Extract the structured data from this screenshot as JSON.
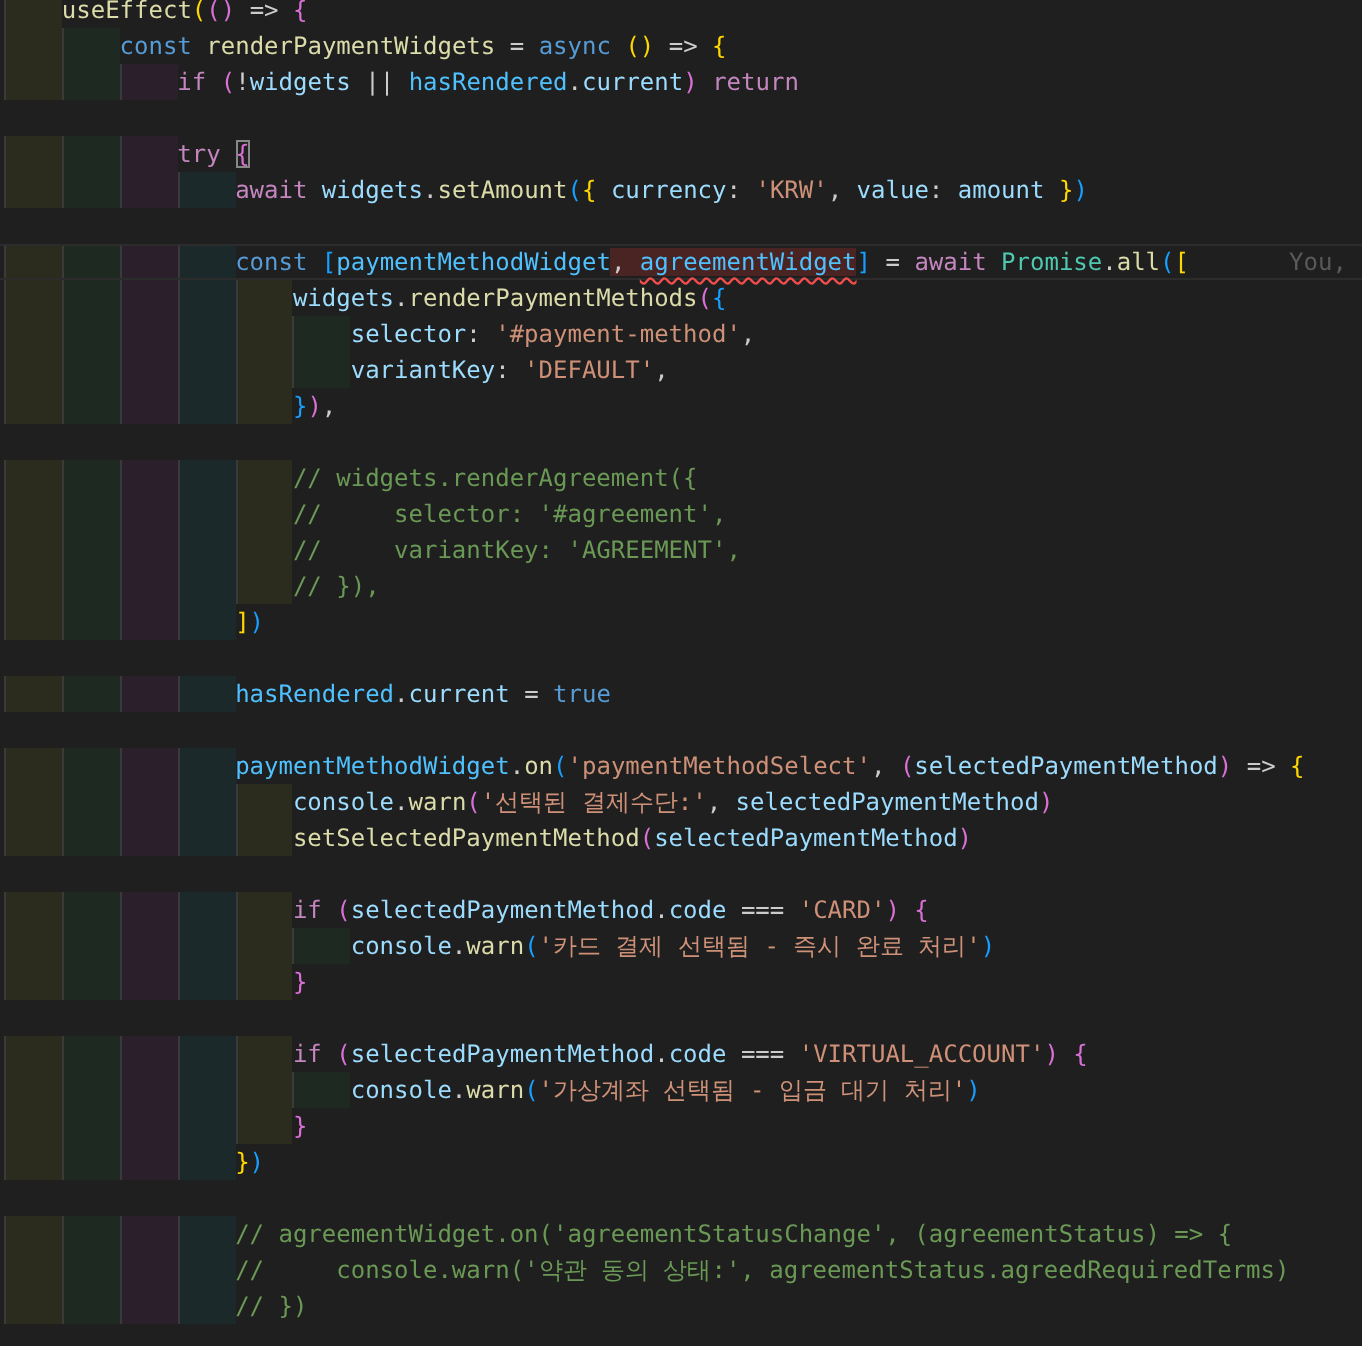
{
  "editor": {
    "lines": [
      {
        "kind": "code",
        "tokens": [
          {
            "kind": "fn",
            "text": "useEffect"
          },
          {
            "kind": "b1",
            "text": "("
          },
          {
            "kind": "b2",
            "text": "()"
          },
          {
            "kind": "p",
            "text": " => "
          },
          {
            "kind": "b2",
            "text": "{"
          }
        ],
        "children": [
          {
            "kind": "code",
            "tokens": [
              {
                "kind": "kw",
                "text": "const "
              },
              {
                "kind": "fn",
                "text": "renderPaymentWidgets"
              },
              {
                "kind": "p",
                "text": " = "
              },
              {
                "kind": "kw",
                "text": "async "
              },
              {
                "kind": "b1",
                "text": "()"
              },
              {
                "kind": "p",
                "text": " => "
              },
              {
                "kind": "b1",
                "text": "{"
              }
            ],
            "children": [
              {
                "kind": "code",
                "tokens": [
                  {
                    "kind": "ctrl",
                    "text": "if "
                  },
                  {
                    "kind": "b2",
                    "text": "("
                  },
                  {
                    "kind": "p",
                    "text": "!"
                  },
                  {
                    "kind": "var",
                    "text": "widgets"
                  },
                  {
                    "kind": "p",
                    "text": " || "
                  },
                  {
                    "kind": "const",
                    "text": "hasRendered"
                  },
                  {
                    "kind": "p",
                    "text": "."
                  },
                  {
                    "kind": "var",
                    "text": "current"
                  },
                  {
                    "kind": "b2",
                    "text": ")"
                  },
                  {
                    "kind": "ctrl",
                    "text": " return"
                  }
                ]
              },
              {
                "kind": "blank"
              },
              {
                "kind": "code",
                "tokens": [
                  {
                    "kind": "ctrl",
                    "text": "try "
                  },
                  {
                    "kind": "b2match",
                    "text": "{"
                  }
                ],
                "children": [
                  {
                    "kind": "code",
                    "tokens": [
                      {
                        "kind": "ctrl",
                        "text": "await "
                      },
                      {
                        "kind": "var",
                        "text": "widgets"
                      },
                      {
                        "kind": "p",
                        "text": "."
                      },
                      {
                        "kind": "fn",
                        "text": "setAmount"
                      },
                      {
                        "kind": "b3",
                        "text": "("
                      },
                      {
                        "kind": "b1",
                        "text": "{"
                      },
                      {
                        "kind": "var",
                        "text": " currency"
                      },
                      {
                        "kind": "p",
                        "text": ": "
                      },
                      {
                        "kind": "str",
                        "text": "'KRW'"
                      },
                      {
                        "kind": "p",
                        "text": ", "
                      },
                      {
                        "kind": "var",
                        "text": "value"
                      },
                      {
                        "kind": "p",
                        "text": ": "
                      },
                      {
                        "kind": "var",
                        "text": "amount "
                      },
                      {
                        "kind": "b1",
                        "text": "}"
                      },
                      {
                        "kind": "b3",
                        "text": ")"
                      }
                    ]
                  },
                  {
                    "kind": "blank"
                  },
                  {
                    "kind": "current",
                    "tokens": [
                      {
                        "kind": "kw",
                        "text": "const "
                      },
                      {
                        "kind": "b3",
                        "text": "["
                      },
                      {
                        "kind": "const",
                        "text": "paymentMethodWidget"
                      },
                      {
                        "kind": "phl",
                        "text": ", "
                      },
                      {
                        "kind": "consterr",
                        "text": "agreementWidget"
                      },
                      {
                        "kind": "b3",
                        "text": "]"
                      },
                      {
                        "kind": "p",
                        "text": " = "
                      },
                      {
                        "kind": "ctrl",
                        "text": "await "
                      },
                      {
                        "kind": "cls",
                        "text": "Promise"
                      },
                      {
                        "kind": "p",
                        "text": "."
                      },
                      {
                        "kind": "fn",
                        "text": "all"
                      },
                      {
                        "kind": "b3",
                        "text": "("
                      },
                      {
                        "kind": "b1",
                        "text": "["
                      }
                    ],
                    "blame": "You,",
                    "children": [
                      {
                        "kind": "code",
                        "tokens": [
                          {
                            "kind": "var",
                            "text": "widgets"
                          },
                          {
                            "kind": "p",
                            "text": "."
                          },
                          {
                            "kind": "fn",
                            "text": "renderPaymentMethods"
                          },
                          {
                            "kind": "b2",
                            "text": "("
                          },
                          {
                            "kind": "b3",
                            "text": "{"
                          }
                        ],
                        "children": [
                          {
                            "kind": "code",
                            "tokens": [
                              {
                                "kind": "var",
                                "text": "selector"
                              },
                              {
                                "kind": "p",
                                "text": ": "
                              },
                              {
                                "kind": "str",
                                "text": "'#payment-method'"
                              },
                              {
                                "kind": "p",
                                "text": ","
                              }
                            ]
                          },
                          {
                            "kind": "code",
                            "tokens": [
                              {
                                "kind": "var",
                                "text": "variantKey"
                              },
                              {
                                "kind": "p",
                                "text": ": "
                              },
                              {
                                "kind": "str",
                                "text": "'DEFAULT'"
                              },
                              {
                                "kind": "p",
                                "text": ","
                              }
                            ]
                          }
                        ]
                      },
                      {
                        "kind": "code",
                        "tokens": [
                          {
                            "kind": "b3",
                            "text": "}"
                          },
                          {
                            "kind": "b2",
                            "text": ")"
                          },
                          {
                            "kind": "p",
                            "text": ","
                          }
                        ]
                      },
                      {
                        "kind": "blank"
                      },
                      {
                        "kind": "code",
                        "tokens": [
                          {
                            "kind": "cmt",
                            "text": "// widgets.renderAgreement({"
                          }
                        ]
                      },
                      {
                        "kind": "code",
                        "tokens": [
                          {
                            "kind": "cmt",
                            "text": "//     selector: '#agreement',"
                          }
                        ]
                      },
                      {
                        "kind": "code",
                        "tokens": [
                          {
                            "kind": "cmt",
                            "text": "//     variantKey: 'AGREEMENT',"
                          }
                        ]
                      },
                      {
                        "kind": "code",
                        "tokens": [
                          {
                            "kind": "cmt",
                            "text": "// }),"
                          }
                        ]
                      }
                    ]
                  },
                  {
                    "kind": "code",
                    "tokens": [
                      {
                        "kind": "b1",
                        "text": "]"
                      },
                      {
                        "kind": "b3",
                        "text": ")"
                      }
                    ]
                  },
                  {
                    "kind": "blank"
                  },
                  {
                    "kind": "code",
                    "tokens": [
                      {
                        "kind": "const",
                        "text": "hasRendered"
                      },
                      {
                        "kind": "p",
                        "text": "."
                      },
                      {
                        "kind": "var",
                        "text": "current"
                      },
                      {
                        "kind": "p",
                        "text": " = "
                      },
                      {
                        "kind": "kw",
                        "text": "true"
                      }
                    ]
                  },
                  {
                    "kind": "blank"
                  },
                  {
                    "kind": "code",
                    "tokens": [
                      {
                        "kind": "const",
                        "text": "paymentMethodWidget"
                      },
                      {
                        "kind": "p",
                        "text": "."
                      },
                      {
                        "kind": "fn",
                        "text": "on"
                      },
                      {
                        "kind": "b3",
                        "text": "("
                      },
                      {
                        "kind": "str",
                        "text": "'paymentMethodSelect'"
                      },
                      {
                        "kind": "p",
                        "text": ", "
                      },
                      {
                        "kind": "b2",
                        "text": "("
                      },
                      {
                        "kind": "var",
                        "text": "selectedPaymentMethod"
                      },
                      {
                        "kind": "b2",
                        "text": ")"
                      },
                      {
                        "kind": "p",
                        "text": " => "
                      },
                      {
                        "kind": "b1",
                        "text": "{"
                      }
                    ],
                    "children": [
                      {
                        "kind": "code",
                        "tokens": [
                          {
                            "kind": "var",
                            "text": "console"
                          },
                          {
                            "kind": "p",
                            "text": "."
                          },
                          {
                            "kind": "fn",
                            "text": "warn"
                          },
                          {
                            "kind": "b2",
                            "text": "("
                          },
                          {
                            "kind": "str",
                            "text": "'선택된 결제수단:'"
                          },
                          {
                            "kind": "p",
                            "text": ", "
                          },
                          {
                            "kind": "var",
                            "text": "selectedPaymentMethod"
                          },
                          {
                            "kind": "b2",
                            "text": ")"
                          }
                        ]
                      },
                      {
                        "kind": "code",
                        "tokens": [
                          {
                            "kind": "fn",
                            "text": "setSelectedPaymentMethod"
                          },
                          {
                            "kind": "b2",
                            "text": "("
                          },
                          {
                            "kind": "var",
                            "text": "selectedPaymentMethod"
                          },
                          {
                            "kind": "b2",
                            "text": ")"
                          }
                        ]
                      },
                      {
                        "kind": "blank"
                      },
                      {
                        "kind": "code",
                        "tokens": [
                          {
                            "kind": "ctrl",
                            "text": "if "
                          },
                          {
                            "kind": "b2",
                            "text": "("
                          },
                          {
                            "kind": "var",
                            "text": "selectedPaymentMethod"
                          },
                          {
                            "kind": "p",
                            "text": "."
                          },
                          {
                            "kind": "var",
                            "text": "code"
                          },
                          {
                            "kind": "p",
                            "text": " === "
                          },
                          {
                            "kind": "str",
                            "text": "'CARD'"
                          },
                          {
                            "kind": "b2",
                            "text": ") {"
                          }
                        ],
                        "children": [
                          {
                            "kind": "code",
                            "tokens": [
                              {
                                "kind": "var",
                                "text": "console"
                              },
                              {
                                "kind": "p",
                                "text": "."
                              },
                              {
                                "kind": "fn",
                                "text": "warn"
                              },
                              {
                                "kind": "b3",
                                "text": "("
                              },
                              {
                                "kind": "str",
                                "text": "'카드 결제 선택됨 - 즉시 완료 처리'"
                              },
                              {
                                "kind": "b3",
                                "text": ")"
                              }
                            ]
                          }
                        ]
                      },
                      {
                        "kind": "code",
                        "tokens": [
                          {
                            "kind": "b2",
                            "text": "}"
                          }
                        ]
                      },
                      {
                        "kind": "blank"
                      },
                      {
                        "kind": "code",
                        "tokens": [
                          {
                            "kind": "ctrl",
                            "text": "if "
                          },
                          {
                            "kind": "b2",
                            "text": "("
                          },
                          {
                            "kind": "var",
                            "text": "selectedPaymentMethod"
                          },
                          {
                            "kind": "p",
                            "text": "."
                          },
                          {
                            "kind": "var",
                            "text": "code"
                          },
                          {
                            "kind": "p",
                            "text": " === "
                          },
                          {
                            "kind": "str",
                            "text": "'VIRTUAL_ACCOUNT'"
                          },
                          {
                            "kind": "b2",
                            "text": ") {"
                          }
                        ],
                        "children": [
                          {
                            "kind": "code",
                            "tokens": [
                              {
                                "kind": "var",
                                "text": "console"
                              },
                              {
                                "kind": "p",
                                "text": "."
                              },
                              {
                                "kind": "fn",
                                "text": "warn"
                              },
                              {
                                "kind": "b3",
                                "text": "("
                              },
                              {
                                "kind": "str",
                                "text": "'가상계좌 선택됨 - 입금 대기 처리'"
                              },
                              {
                                "kind": "b3",
                                "text": ")"
                              }
                            ]
                          }
                        ]
                      },
                      {
                        "kind": "code",
                        "tokens": [
                          {
                            "kind": "b2",
                            "text": "}"
                          }
                        ]
                      }
                    ]
                  },
                  {
                    "kind": "code",
                    "tokens": [
                      {
                        "kind": "b1",
                        "text": "}"
                      },
                      {
                        "kind": "b3",
                        "text": ")"
                      }
                    ]
                  },
                  {
                    "kind": "blank"
                  },
                  {
                    "kind": "code",
                    "tokens": [
                      {
                        "kind": "cmt",
                        "text": "// agreementWidget.on('agreementStatusChange', (agreementStatus) => {"
                      }
                    ]
                  },
                  {
                    "kind": "code",
                    "tokens": [
                      {
                        "kind": "cmt",
                        "text": "//     console.warn('약관 동의 상태:', agreementStatus.agreedRequiredTerms)"
                      }
                    ]
                  },
                  {
                    "kind": "code",
                    "tokens": [
                      {
                        "kind": "cmt",
                        "text": "// })"
                      }
                    ]
                  }
                ]
              }
            ]
          }
        ]
      }
    ]
  }
}
